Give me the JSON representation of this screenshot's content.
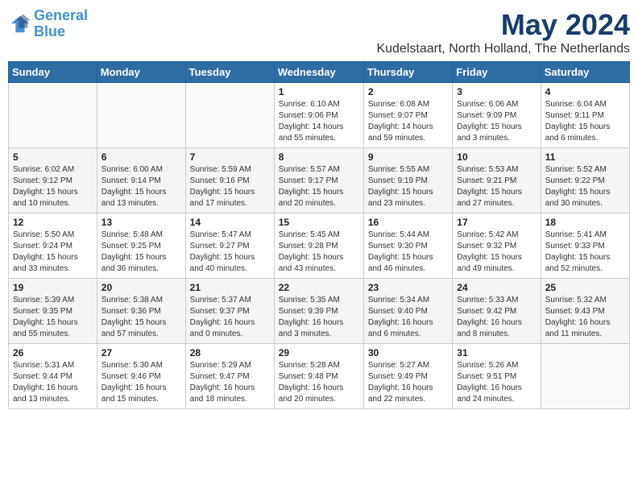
{
  "header": {
    "logo_line1": "General",
    "logo_line2": "Blue",
    "title": "May 2024",
    "subtitle": "Kudelstaart, North Holland, The Netherlands"
  },
  "days_of_week": [
    "Sunday",
    "Monday",
    "Tuesday",
    "Wednesday",
    "Thursday",
    "Friday",
    "Saturday"
  ],
  "weeks": [
    [
      {
        "day": "",
        "info": ""
      },
      {
        "day": "",
        "info": ""
      },
      {
        "day": "",
        "info": ""
      },
      {
        "day": "1",
        "info": "Sunrise: 6:10 AM\nSunset: 9:06 PM\nDaylight: 14 hours\nand 55 minutes."
      },
      {
        "day": "2",
        "info": "Sunrise: 6:08 AM\nSunset: 9:07 PM\nDaylight: 14 hours\nand 59 minutes."
      },
      {
        "day": "3",
        "info": "Sunrise: 6:06 AM\nSunset: 9:09 PM\nDaylight: 15 hours\nand 3 minutes."
      },
      {
        "day": "4",
        "info": "Sunrise: 6:04 AM\nSunset: 9:11 PM\nDaylight: 15 hours\nand 6 minutes."
      }
    ],
    [
      {
        "day": "5",
        "info": "Sunrise: 6:02 AM\nSunset: 9:12 PM\nDaylight: 15 hours\nand 10 minutes."
      },
      {
        "day": "6",
        "info": "Sunrise: 6:00 AM\nSunset: 9:14 PM\nDaylight: 15 hours\nand 13 minutes."
      },
      {
        "day": "7",
        "info": "Sunrise: 5:59 AM\nSunset: 9:16 PM\nDaylight: 15 hours\nand 17 minutes."
      },
      {
        "day": "8",
        "info": "Sunrise: 5:57 AM\nSunset: 9:17 PM\nDaylight: 15 hours\nand 20 minutes."
      },
      {
        "day": "9",
        "info": "Sunrise: 5:55 AM\nSunset: 9:19 PM\nDaylight: 15 hours\nand 23 minutes."
      },
      {
        "day": "10",
        "info": "Sunrise: 5:53 AM\nSunset: 9:21 PM\nDaylight: 15 hours\nand 27 minutes."
      },
      {
        "day": "11",
        "info": "Sunrise: 5:52 AM\nSunset: 9:22 PM\nDaylight: 15 hours\nand 30 minutes."
      }
    ],
    [
      {
        "day": "12",
        "info": "Sunrise: 5:50 AM\nSunset: 9:24 PM\nDaylight: 15 hours\nand 33 minutes."
      },
      {
        "day": "13",
        "info": "Sunrise: 5:48 AM\nSunset: 9:25 PM\nDaylight: 15 hours\nand 36 minutes."
      },
      {
        "day": "14",
        "info": "Sunrise: 5:47 AM\nSunset: 9:27 PM\nDaylight: 15 hours\nand 40 minutes."
      },
      {
        "day": "15",
        "info": "Sunrise: 5:45 AM\nSunset: 9:28 PM\nDaylight: 15 hours\nand 43 minutes."
      },
      {
        "day": "16",
        "info": "Sunrise: 5:44 AM\nSunset: 9:30 PM\nDaylight: 15 hours\nand 46 minutes."
      },
      {
        "day": "17",
        "info": "Sunrise: 5:42 AM\nSunset: 9:32 PM\nDaylight: 15 hours\nand 49 minutes."
      },
      {
        "day": "18",
        "info": "Sunrise: 5:41 AM\nSunset: 9:33 PM\nDaylight: 15 hours\nand 52 minutes."
      }
    ],
    [
      {
        "day": "19",
        "info": "Sunrise: 5:39 AM\nSunset: 9:35 PM\nDaylight: 15 hours\nand 55 minutes."
      },
      {
        "day": "20",
        "info": "Sunrise: 5:38 AM\nSunset: 9:36 PM\nDaylight: 15 hours\nand 57 minutes."
      },
      {
        "day": "21",
        "info": "Sunrise: 5:37 AM\nSunset: 9:37 PM\nDaylight: 16 hours\nand 0 minutes."
      },
      {
        "day": "22",
        "info": "Sunrise: 5:35 AM\nSunset: 9:39 PM\nDaylight: 16 hours\nand 3 minutes."
      },
      {
        "day": "23",
        "info": "Sunrise: 5:34 AM\nSunset: 9:40 PM\nDaylight: 16 hours\nand 6 minutes."
      },
      {
        "day": "24",
        "info": "Sunrise: 5:33 AM\nSunset: 9:42 PM\nDaylight: 16 hours\nand 8 minutes."
      },
      {
        "day": "25",
        "info": "Sunrise: 5:32 AM\nSunset: 9:43 PM\nDaylight: 16 hours\nand 11 minutes."
      }
    ],
    [
      {
        "day": "26",
        "info": "Sunrise: 5:31 AM\nSunset: 9:44 PM\nDaylight: 16 hours\nand 13 minutes."
      },
      {
        "day": "27",
        "info": "Sunrise: 5:30 AM\nSunset: 9:46 PM\nDaylight: 16 hours\nand 15 minutes."
      },
      {
        "day": "28",
        "info": "Sunrise: 5:29 AM\nSunset: 9:47 PM\nDaylight: 16 hours\nand 18 minutes."
      },
      {
        "day": "29",
        "info": "Sunrise: 5:28 AM\nSunset: 9:48 PM\nDaylight: 16 hours\nand 20 minutes."
      },
      {
        "day": "30",
        "info": "Sunrise: 5:27 AM\nSunset: 9:49 PM\nDaylight: 16 hours\nand 22 minutes."
      },
      {
        "day": "31",
        "info": "Sunrise: 5:26 AM\nSunset: 9:51 PM\nDaylight: 16 hours\nand 24 minutes."
      },
      {
        "day": "",
        "info": ""
      }
    ]
  ]
}
